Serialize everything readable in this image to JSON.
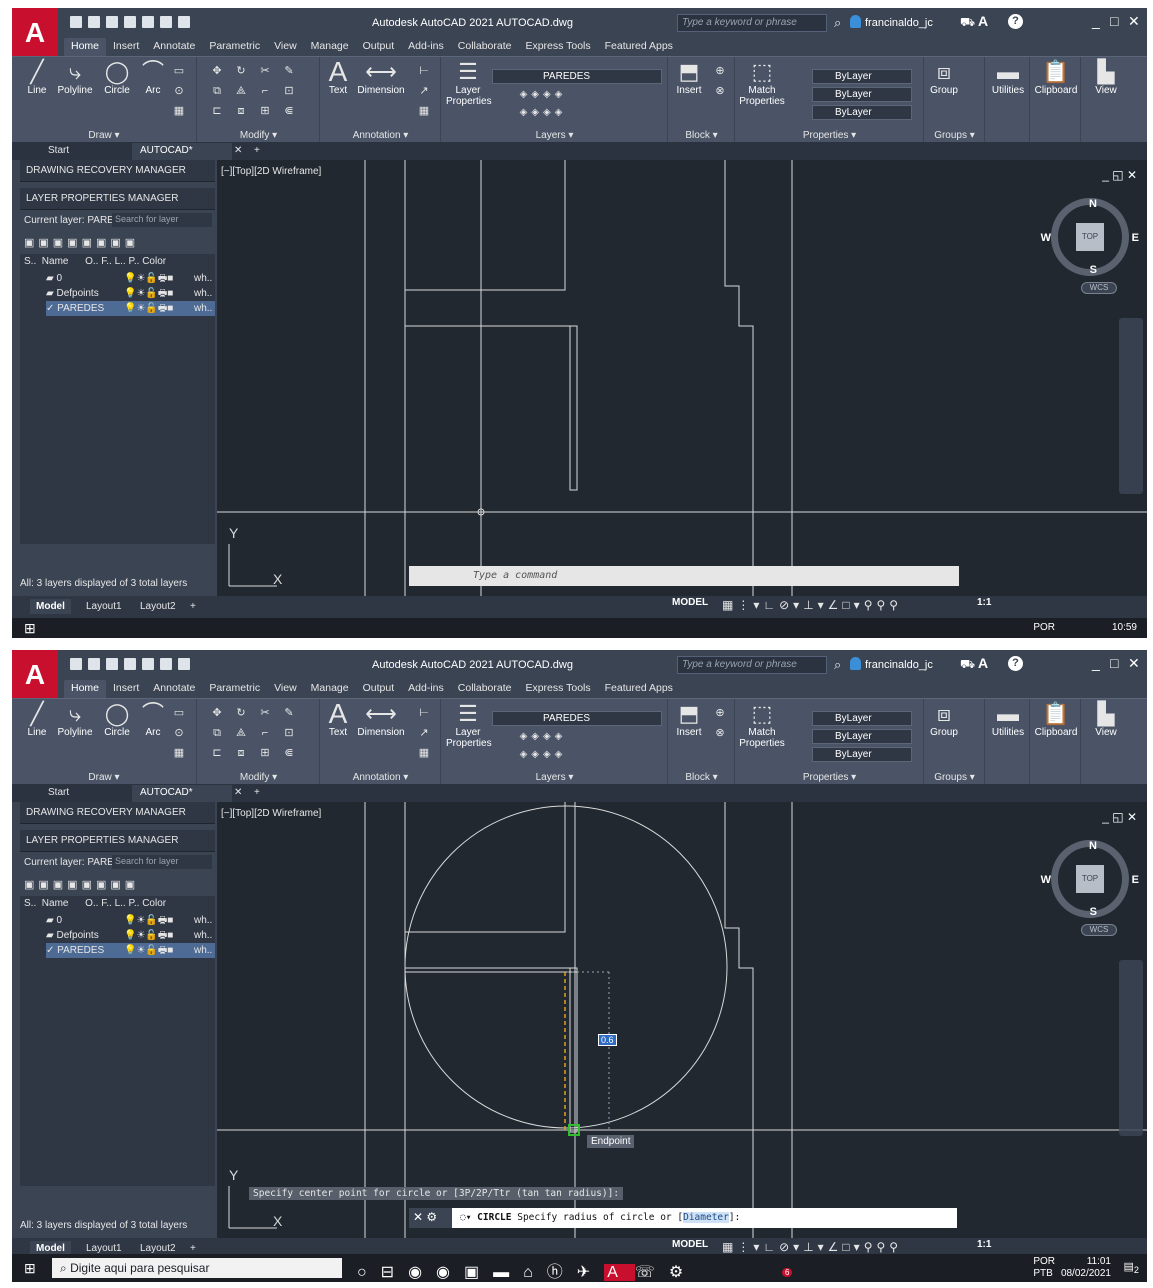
{
  "app": {
    "title": "Autodesk AutoCAD 2021   AUTOCAD.dwg",
    "search_placeholder": "Type a keyword or phrase",
    "user": "francinaldo_jc"
  },
  "ribbon": {
    "tabs": [
      "Home",
      "Insert",
      "Annotate",
      "Parametric",
      "View",
      "Manage",
      "Output",
      "Add-ins",
      "Collaborate",
      "Express Tools",
      "Featured Apps"
    ],
    "draw": {
      "line": "Line",
      "polyline": "Polyline",
      "circle": "Circle",
      "arc": "Arc",
      "title": "Draw ▾"
    },
    "modify_title": "Modify ▾",
    "annotation": {
      "text": "Text",
      "dimension": "Dimension",
      "title": "Annotation ▾"
    },
    "layers": {
      "properties_1": "Layer",
      "properties_2": "Properties",
      "current": "PAREDES",
      "title": "Layers ▾"
    },
    "block": {
      "insert": "Insert",
      "title": "Block ▾"
    },
    "properties": {
      "match_1": "Match",
      "match_2": "Properties",
      "color": "ByLayer",
      "lineweight": "ByLayer",
      "linetype": "ByLayer",
      "title": "Properties ▾"
    },
    "groups": {
      "group": "Group",
      "title": "Groups ▾"
    },
    "utilities": "Utilities",
    "clipboard": "Clipboard",
    "view": "View"
  },
  "filetabs": {
    "start": "Start",
    "active": "AUTOCAD*"
  },
  "palettes": {
    "recovery": "DRAWING RECOVERY MANAGER",
    "layers_header": "LAYER PROPERTIES MANAGER",
    "current_layer": "Current layer: PARE",
    "search_placeholder": "Search for layer",
    "columns": "S..  Name      O.. F.. L.. P.. Color",
    "rows": [
      "0",
      "Defpoints",
      "PAREDES"
    ],
    "color_value": "wh..",
    "status": "All: 3 layers displayed of 3 total layers"
  },
  "viewport": {
    "label": "[−][Top][2D Wireframe]"
  },
  "viewcube": {
    "n": "N",
    "s": "S",
    "e": "E",
    "w": "W",
    "top": "TOP",
    "wcs": "WCS"
  },
  "command": {
    "placeholder": "Type a command",
    "history": "Specify center point for circle or [3P/2P/Ttr (tan tan radius)]:",
    "active_cmd": "CIRCLE",
    "active_text": " Specify radius of circle or [",
    "active_option": "Diameter",
    "active_end": "]:"
  },
  "osnap_tooltip": "Endpoint",
  "dim_input": "0.6",
  "layout_tabs": [
    "Model",
    "Layout1",
    "Layout2"
  ],
  "statusbar": {
    "model": "MODEL",
    "scale": "1:1"
  },
  "taskbar": {
    "search": "Digite aqui para pesquisar",
    "lang_top": "POR",
    "lang_bottom": "PTB",
    "time_top": "10:59",
    "time_bottom": "11:01",
    "date": "08/02/2021",
    "notif_count": "2",
    "badge": "6"
  }
}
